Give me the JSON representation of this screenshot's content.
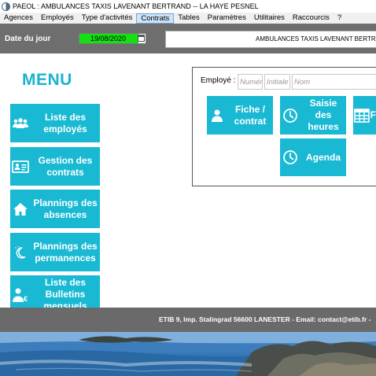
{
  "window": {
    "title": "PAEOL : AMBULANCES TAXIS LAVENANT BERTRAND -- LA HAYE PESNEL"
  },
  "menubar": {
    "items": [
      "Agences",
      "Employés",
      "Type d'activités",
      "Contrats",
      "Tables",
      "Paramètres",
      "Utilitaires",
      "Raccourcis",
      "?"
    ],
    "active": "Contrats"
  },
  "topbar": {
    "date_label": "Date du jour",
    "date_value": "19/08/2020",
    "company": "AMBULANCES TAXIS LAVENANT BERTRAND"
  },
  "menu": {
    "title": "MENU",
    "buttons": [
      {
        "label": "Liste des employés",
        "icon": "users-icon"
      },
      {
        "label": "Gestion des contrats",
        "icon": "id-card-icon"
      },
      {
        "label": "Plannings des absences",
        "icon": "home-icon"
      },
      {
        "label": "Plannings des permanences",
        "icon": "moon-icon"
      },
      {
        "label": "Liste des Bulletins mensuels",
        "icon": "user-euro-icon"
      }
    ]
  },
  "employee": {
    "label": "Employé :",
    "number_placeholder": "Numéro",
    "initials_placeholder": "Initiale",
    "name_placeholder": "Nom",
    "buttons": [
      {
        "label": "Fiche / contrat",
        "icon": "user-icon"
      },
      {
        "label": "Saisie des heures",
        "icon": "clock-icon"
      },
      {
        "label": "F",
        "icon": "table-icon"
      },
      {
        "label": "Agenda",
        "icon": "clock-icon"
      }
    ]
  },
  "footer": {
    "text": "ETIB 9, Imp. Stalingrad  56600 LANESTER -  Email: contact@etib.fr -"
  },
  "colors": {
    "accent": "#19b9d4",
    "title": "#19b3cf",
    "bar": "#6e6e6e",
    "date_highlight": "#14e014"
  }
}
